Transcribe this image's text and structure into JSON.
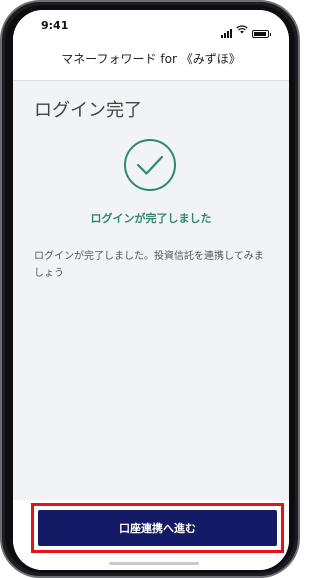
{
  "status_bar": {
    "time": "9:41",
    "icons": [
      "cellular-signal-icon",
      "wifi-icon",
      "battery-icon"
    ]
  },
  "header": {
    "title": "マネーフォワード for 《みずほ》"
  },
  "main": {
    "page_title": "ログイン完了",
    "status_icon": "check-circle-icon",
    "success_message": "ログインが完了しました",
    "description": "ログインが完了しました。投資信託を連携してみましょう"
  },
  "actions": {
    "primary_button_label": "口座連携へ進む"
  },
  "colors": {
    "accent_green": "#2e8a68",
    "button_navy": "#131a66",
    "highlight_red": "#e3131a"
  }
}
